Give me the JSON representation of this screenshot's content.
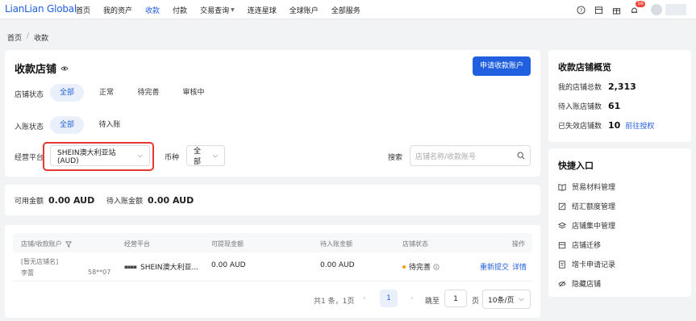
{
  "brand": "LianLian Global",
  "nav": [
    {
      "label": "首页",
      "active": false,
      "caret": false
    },
    {
      "label": "我的资产",
      "active": false,
      "caret": false
    },
    {
      "label": "收款",
      "active": true,
      "caret": false
    },
    {
      "label": "付款",
      "active": false,
      "caret": false
    },
    {
      "label": "交易查询",
      "active": false,
      "caret": true
    },
    {
      "label": "连连星球",
      "active": false,
      "caret": false
    },
    {
      "label": "全球账户",
      "active": false,
      "caret": false
    },
    {
      "label": "全部服务",
      "active": false,
      "caret": false
    }
  ],
  "notif_count": "56",
  "breadcrumb": {
    "home": "首页",
    "current": "收款"
  },
  "store": {
    "title": "收款店铺",
    "apply_button": "申请收款账户",
    "status_label": "店铺状态",
    "status_filters": [
      "全部",
      "正常",
      "待完善",
      "审核中"
    ],
    "account_label": "入账状态",
    "account_filters": [
      "全部",
      "待入账"
    ],
    "platform_label": "经营平台",
    "platform_value": "SHEIN澳大利亚站(AUD)",
    "currency_label": "币种",
    "currency_value": "全部",
    "search_label": "搜索",
    "search_placeholder": "店铺名称/收款账号"
  },
  "balance": {
    "available_label": "可用金额",
    "available_value": "0.00 AUD",
    "pending_label": "待入账金额",
    "pending_value": "0.00 AUD"
  },
  "table": {
    "headers": [
      "店铺/收款账户",
      "经营平台",
      "可提现金额",
      "待入账金额",
      "店铺状态",
      "操作"
    ],
    "rows": [
      {
        "store_name": "[暂无店铺名]",
        "owner": "李蕾",
        "account": "58**07",
        "platform": "SHEIN澳大利亚...",
        "withdrawable": "0.00 AUD",
        "pending": "0.00 AUD",
        "status": "待完善",
        "action_resubmit": "重新提交",
        "action_detail": "详情"
      }
    ]
  },
  "pagination": {
    "total": "共1 条，1页",
    "current_page": "1",
    "jump_label": "跳至",
    "jump_value": "1",
    "page_unit": "页",
    "page_size": "10条/页"
  },
  "overview": {
    "title": "收款店铺概览",
    "items": [
      {
        "label": "我的店铺总数",
        "value": "2,313"
      },
      {
        "label": "待入账店铺数",
        "value": "61"
      },
      {
        "label": "已失效店铺数",
        "value": "10",
        "link": "前往授权"
      }
    ]
  },
  "quick": {
    "title": "快捷入口",
    "items": [
      {
        "label": "贸易材料管理",
        "icon": "book-icon"
      },
      {
        "label": "结汇额度管理",
        "icon": "edit-doc-icon"
      },
      {
        "label": "店铺集中管理",
        "icon": "layers-icon"
      },
      {
        "label": "店铺迁移",
        "icon": "store-icon"
      },
      {
        "label": "增卡申请记录",
        "icon": "doc-list-icon"
      },
      {
        "label": "隐藏店铺",
        "icon": "eye-off-icon"
      }
    ]
  },
  "colors": {
    "primary": "#1f5fe0",
    "highlight_border": "#e53935",
    "badge": "#f04438",
    "warning": "#f59e0b"
  }
}
